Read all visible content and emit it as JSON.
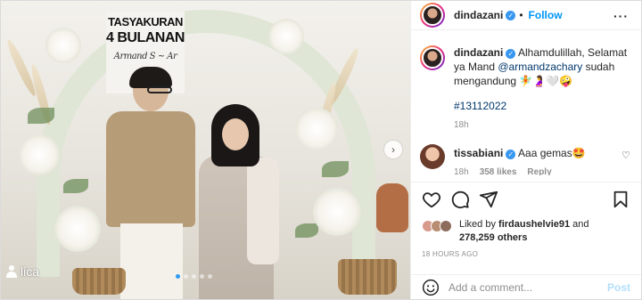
{
  "photo": {
    "sign": {
      "line1": "TASYAKURAN",
      "line2": "4 BULANAN",
      "line3": "Armand S ~ Ar"
    },
    "watermark": "lica",
    "slide_total": 5,
    "slide_active": 1
  },
  "header": {
    "username": "dindazani",
    "separator": "•",
    "follow_label": "Follow",
    "more_label": "···"
  },
  "caption": {
    "username": "dindazani",
    "text_before": " Alhamdulillah, Selamat ya Mand ",
    "mention": "@armandzachary",
    "text_after": " sudah mengandung 🧚🤰🤍🤪",
    "hashtag": "#13112022",
    "time": "18h"
  },
  "comment": {
    "username": "tissabiani",
    "text": " Aaa gemas🤩",
    "time": "18h",
    "likes": "358 likes",
    "reply_label": "Reply"
  },
  "likes": {
    "prefix": "Liked by ",
    "user": "firdaushelvie91",
    "middle": " and",
    "count": "278,259 others"
  },
  "timestamp": "18 HOURS AGO",
  "add_comment": {
    "placeholder": "Add a comment...",
    "post_label": "Post"
  },
  "colors": {
    "accent": "#0095f6",
    "verified": "#3897f0",
    "post_disabled": "#b2dffc",
    "muted": "#8e8e8e"
  }
}
